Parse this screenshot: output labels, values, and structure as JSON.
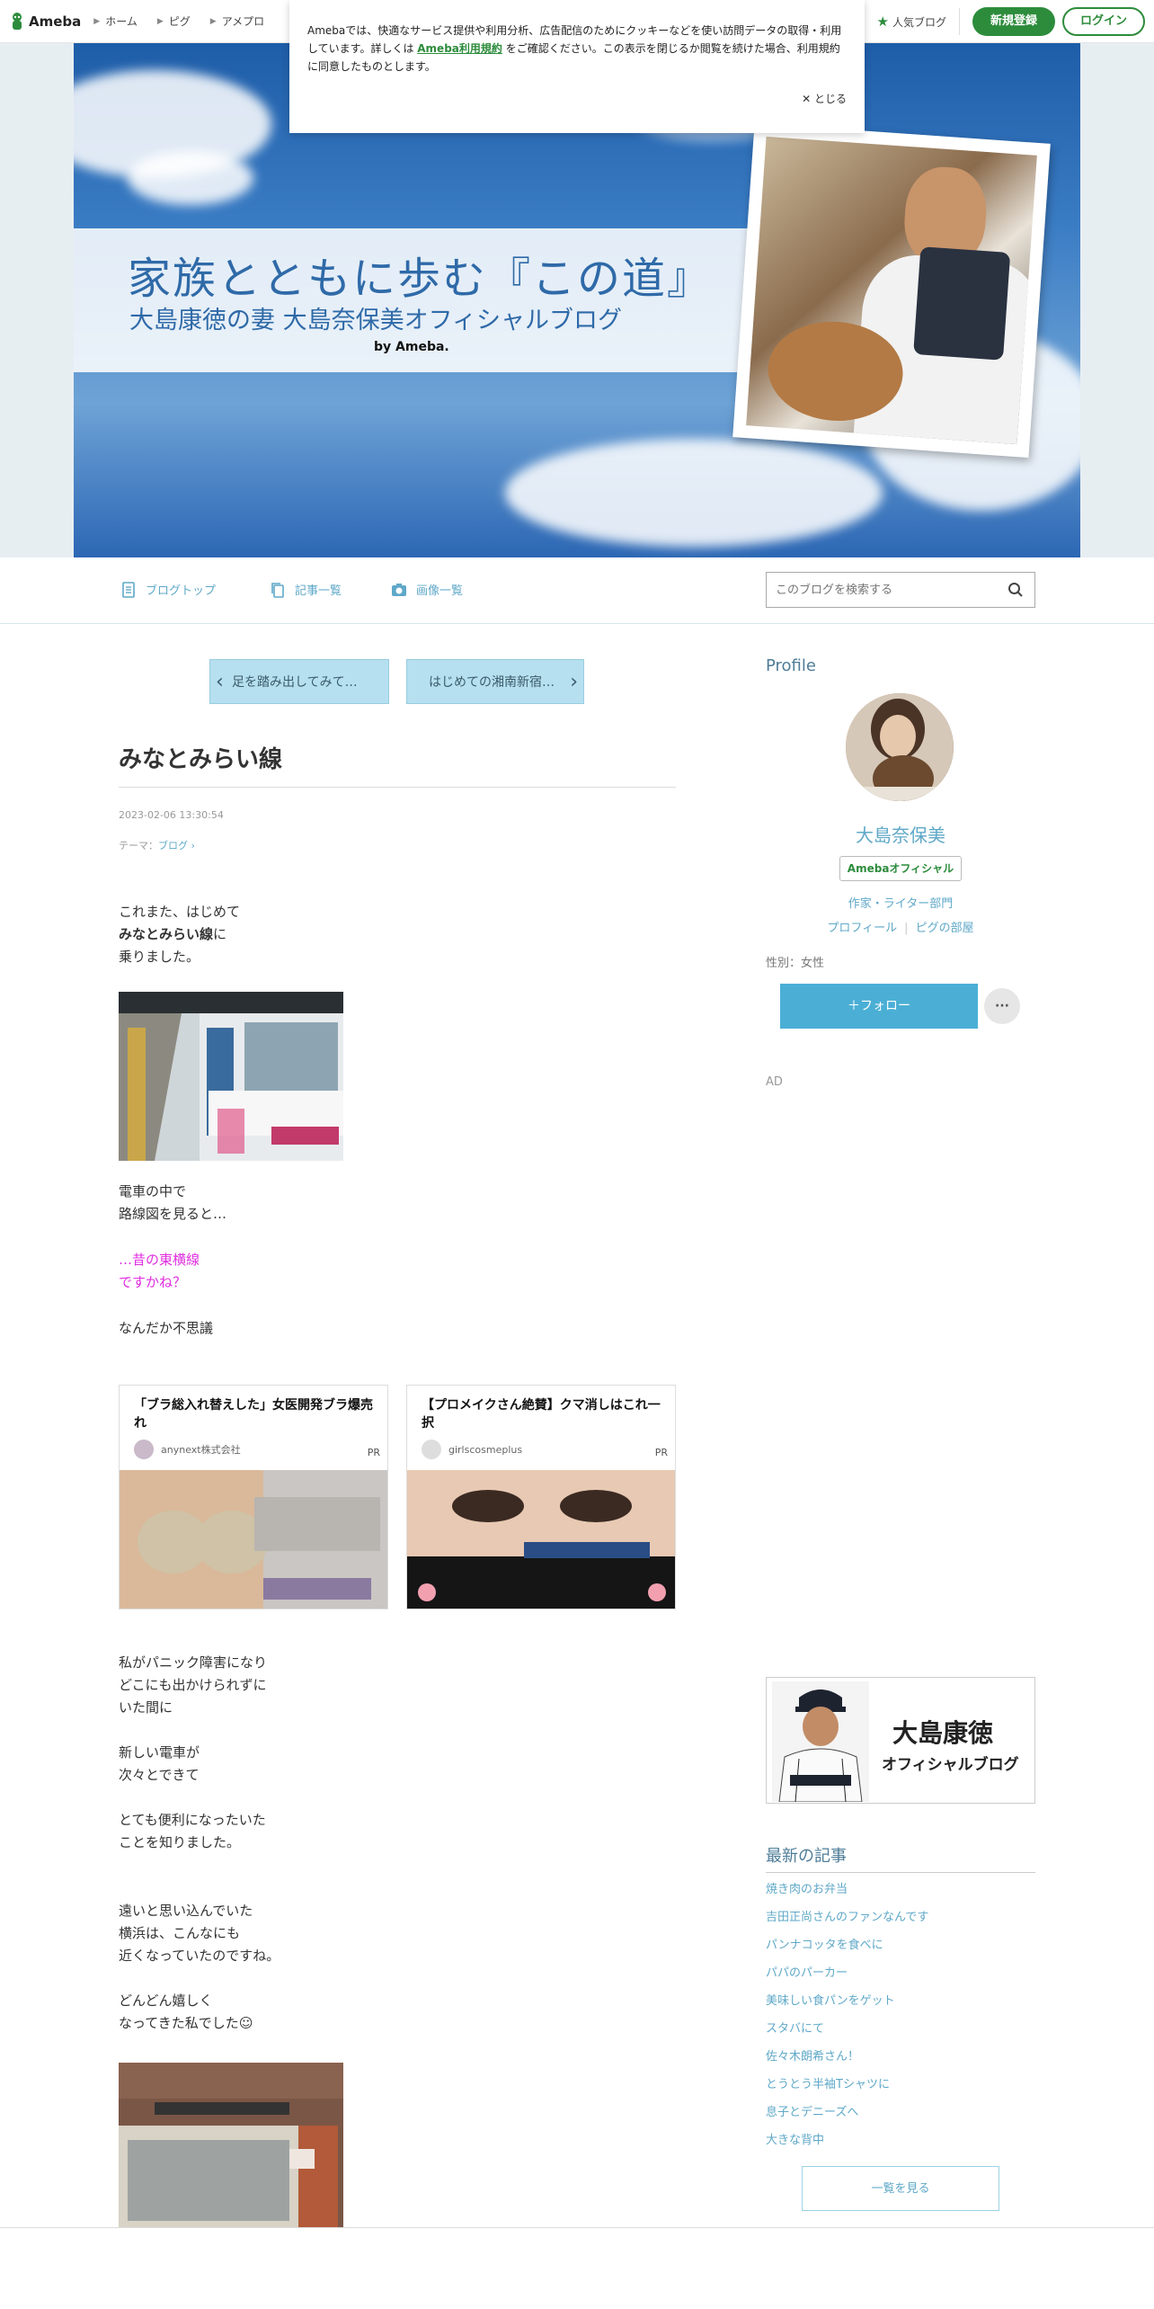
{
  "topbar": {
    "logo_text": "Ameba",
    "nav": [
      "ホーム",
      "ピグ",
      "アメプロ"
    ],
    "popular_label": "人気ブログ",
    "register_label": "新規登録",
    "login_label": "ログイン"
  },
  "cookie": {
    "text_before": "Amebaでは、快適なサービス提供や利用分析、広告配信のためにクッキーなどを使い訪問データの取得・利用しています。詳しくは ",
    "link": "Ameba利用規約",
    "text_after": " をご確認ください。この表示を閉じるか閲覧を続けた場合、利用規約に同意したものとします。",
    "close_label": "とじる"
  },
  "header": {
    "title": "家族とともに歩む『この道』",
    "subtitle": "大島康徳の妻 大島奈保美オフィシャルブログ",
    "by": "by Ameba."
  },
  "blognav": {
    "top": "ブログトップ",
    "entries": "記事一覧",
    "images": "画像一覧",
    "search_placeholder": "このブログを検索する"
  },
  "pager": {
    "prev": "足を踏み出してみて…",
    "next": "はじめての湘南新宿…"
  },
  "post": {
    "title": "みなとみらい線",
    "date": "2023-02-06 13:30:54",
    "theme_label": "テーマ：",
    "theme": "ブログ",
    "p1_line1": "これまた、はじめて",
    "p1_bold": "みなとみらい線",
    "p1_line2_tail": "に",
    "p1_line3": "乗りました。",
    "p2_line1": "電車の中で",
    "p2_line2": "路線図を見ると…",
    "p3_line1": "…昔の東横線",
    "p3_line2": "ですかね？",
    "p4": "なんだか不思議",
    "p5_line1": "私がパニック障害になり",
    "p5_line2": "どこにも出かけられずに",
    "p5_line3": "いた間に",
    "p6_line1": "新しい電車が",
    "p6_line2": "次々とできて",
    "p7_line1": "とても便利になったいた",
    "p7_line2": "ことを知りました。",
    "p8_line1": "遠いと思い込んでいた",
    "p8_line2": "横浜は、こんなにも",
    "p8_line3": "近くなっていたのですね。",
    "p9_line1": "どんどん嬉しく",
    "p9_line2": "なってきた私でした",
    "emoji_alt": "☺"
  },
  "ads": [
    {
      "title": "「ブラ総入れ替えした」女医開発ブラ爆売れ",
      "advertiser": "anynext株式会社",
      "pr": "PR"
    },
    {
      "title": "【プロメイクさん絶賛】クマ消しはこれ一択",
      "advertiser": "girlscosmeplus",
      "pr": "PR"
    }
  ],
  "sidebar": {
    "profile_heading": "Profile",
    "name": "大島奈保美",
    "badge": "Amebaオフィシャル",
    "category": "作家・ライター部門",
    "link_profile": "プロフィール",
    "link_pig": "ピグの部屋",
    "gender": "性別：女性",
    "follow": "＋フォロー",
    "more": "···",
    "ad": "AD",
    "banner_name": "大島康徳",
    "banner_sub": "オフィシャルブログ",
    "latest_heading": "最新の記事",
    "latest": [
      "焼き肉のお弁当",
      "吉田正尚さんのファンなんです",
      "パンナコッタを食べに",
      "パパのパーカー",
      "美味しい食パンをゲット",
      "スタバにて",
      "佐々木朗希さん！",
      "とうとう半袖Tシャツに",
      "息子とデニーズへ",
      "大きな背中"
    ],
    "see_all": "一覧を見る"
  },
  "colors": {
    "ameba_green": "#2d8c3c",
    "link_blue": "#5fa8c8",
    "follow_blue": "#4bafd5",
    "pink": "#e02de0"
  }
}
